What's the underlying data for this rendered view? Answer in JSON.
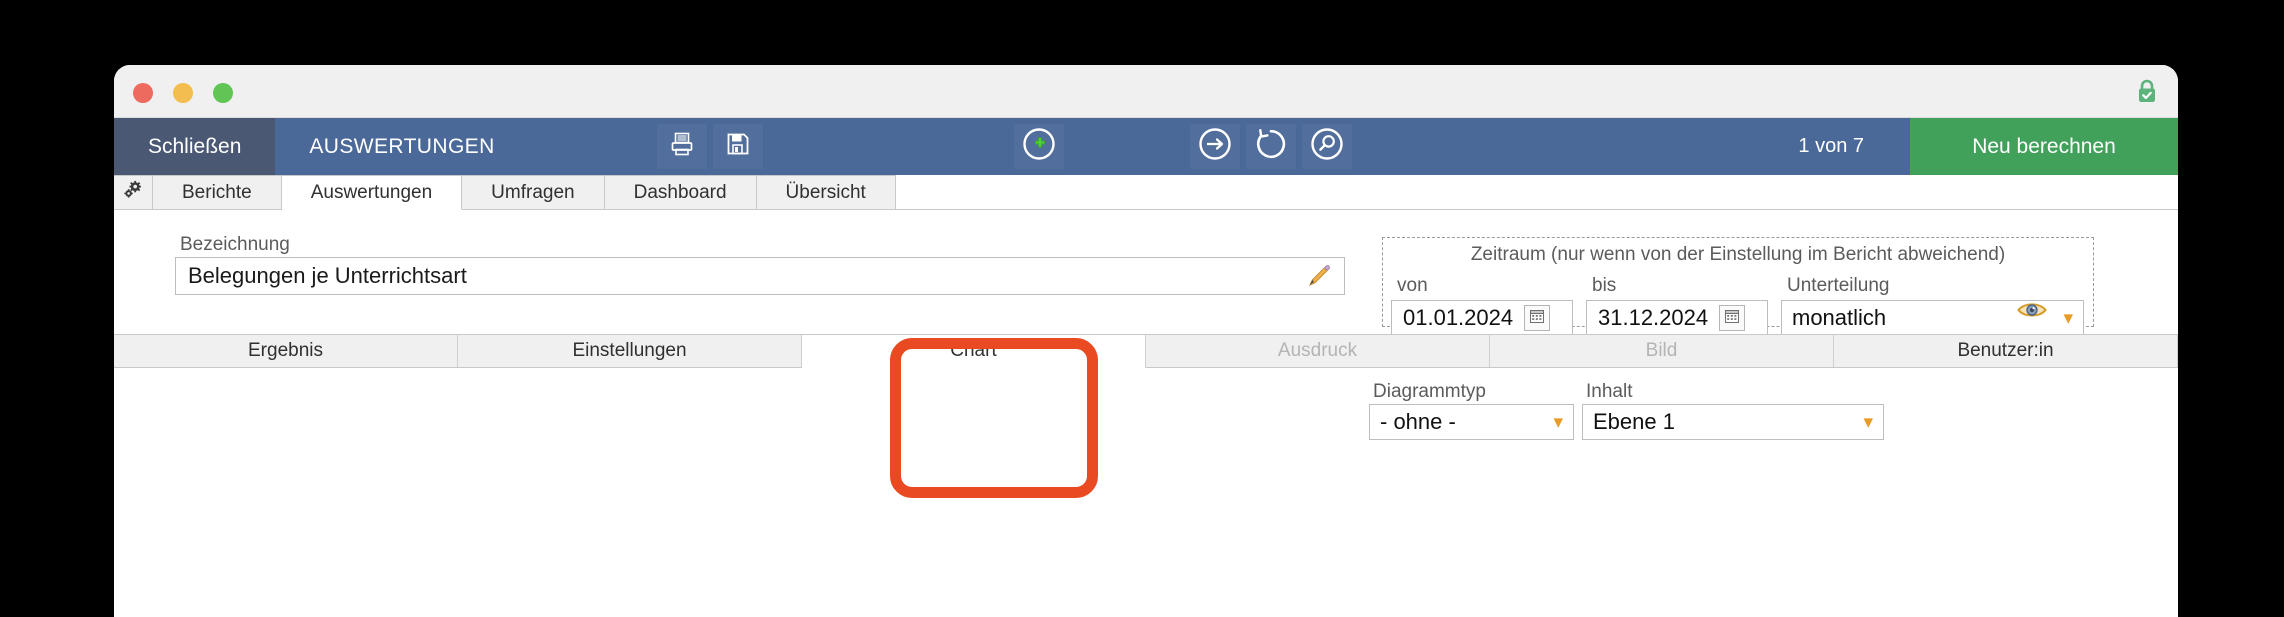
{
  "window": {
    "lock_icon": "lock-secure-icon"
  },
  "toolbar": {
    "close_label": "Schließen",
    "title": "AUSWERTUNGEN",
    "print_icon": "printer-icon",
    "save_icon": "floppy-save-icon",
    "add_icon": "plus-circle-icon",
    "goto_icon": "arrow-right-circle-icon",
    "refresh_icon": "refresh-circle-icon",
    "search_icon": "search-circle-icon",
    "counter": "1 von 7",
    "action_label": "Neu berechnen",
    "accent_blue": "#4a6898",
    "accent_blue_dark": "#4a5873",
    "accent_green": "#41a05a"
  },
  "tabs": {
    "gear_icon": "gears-settings-icon",
    "items": [
      {
        "label": "Berichte",
        "active": false
      },
      {
        "label": "Auswertungen",
        "active": true
      },
      {
        "label": "Umfragen",
        "active": false
      },
      {
        "label": "Dashboard",
        "active": false
      },
      {
        "label": "Übersicht",
        "active": false
      }
    ]
  },
  "form": {
    "bezeichnung_label": "Bezeichnung",
    "bezeichnung_value": "Belegungen je Unterrichtsart",
    "pencil_icon": "pencil-edit-icon",
    "eye_icon": "eye-preview-icon",
    "list_icon": "list-details-icon",
    "zeitraum": {
      "title": "Zeitraum (nur wenn von der Einstellung im Bericht abweichend)",
      "von_label": "von",
      "von_value": "01.01.2024",
      "bis_label": "bis",
      "bis_value": "31.12.2024",
      "unterteilung_label": "Unterteilung",
      "unterteilung_value": "monatlich",
      "calendar_icon": "calendar-picker-icon"
    }
  },
  "subtabs": {
    "items": [
      {
        "label": "Ergebnis",
        "active": false,
        "disabled": false
      },
      {
        "label": "Einstellungen",
        "active": false,
        "disabled": false
      },
      {
        "label": "Chart",
        "active": true,
        "disabled": false
      },
      {
        "label": "Ausdruck",
        "active": false,
        "disabled": true
      },
      {
        "label": "Bild",
        "active": false,
        "disabled": true
      },
      {
        "label": "Benutzer:in",
        "active": false,
        "disabled": false
      }
    ]
  },
  "chart_panel": {
    "diagrammtyp_label": "Diagrammtyp",
    "diagrammtyp_value": "- ohne -",
    "inhalt_label": "Inhalt",
    "inhalt_value": "Ebene 1"
  },
  "annotation": {
    "color": "#ea4a21",
    "target": "Chart"
  }
}
